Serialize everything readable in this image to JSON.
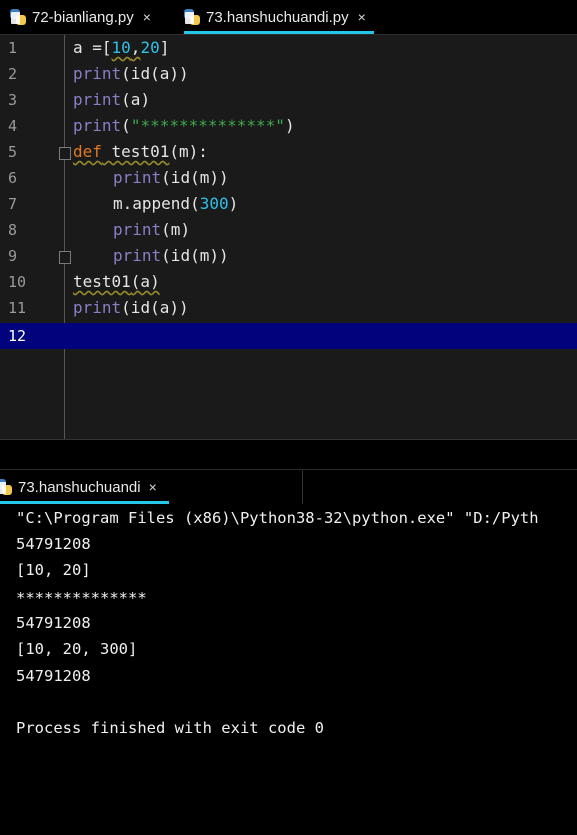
{
  "editor_tabs": [
    {
      "label": "72-bianliang.py",
      "close": "×",
      "active": false
    },
    {
      "label": "73.hanshuchuandi.py",
      "close": "×",
      "active": true
    }
  ],
  "line_numbers": [
    "1",
    "2",
    "3",
    "4",
    "5",
    "6",
    "7",
    "8",
    "9",
    "10",
    "11",
    "12"
  ],
  "code": {
    "l1": {
      "a": "a =[",
      "n1": "10",
      "comma": ",",
      "n2": "20",
      "end": "]"
    },
    "l2": {
      "fn": "print",
      "rest": "(id(a))"
    },
    "l3": {
      "fn": "print",
      "rest": "(a)"
    },
    "l4": {
      "fn": "print",
      "open": "(",
      "str": "\"**************\"",
      "close": ")"
    },
    "l5": {
      "kw": "def",
      "name": " test01",
      "rest": "(m):"
    },
    "l6": {
      "fn": "print",
      "rest": "(id(m))"
    },
    "l7": {
      "pre": "m.append(",
      "num": "300",
      "post": ")"
    },
    "l8": {
      "fn": "print",
      "rest": "(m)"
    },
    "l9": {
      "fn": "print",
      "rest": "(id(m))"
    },
    "l10": {
      "name": "test01",
      "rest": "(a)"
    },
    "l11": {
      "fn": "print",
      "rest": "(id(a))"
    }
  },
  "run_tab": {
    "label": "73.hanshuchuandi",
    "close": "×"
  },
  "console_lines": [
    "\"C:\\Program Files (x86)\\Python38-32\\python.exe\" \"D:/Pyth",
    "54791208",
    "[10, 20]",
    "**************",
    "54791208",
    "[10, 20, 300]",
    "54791208",
    "",
    "Process finished with exit code 0"
  ],
  "colors": {
    "current_line": "#02027c",
    "tab_underline": "#24c7e8",
    "keyword": "#e07a22",
    "builtin": "#8a7fc7",
    "number": "#2ec0e8",
    "string": "#3ea94a"
  }
}
